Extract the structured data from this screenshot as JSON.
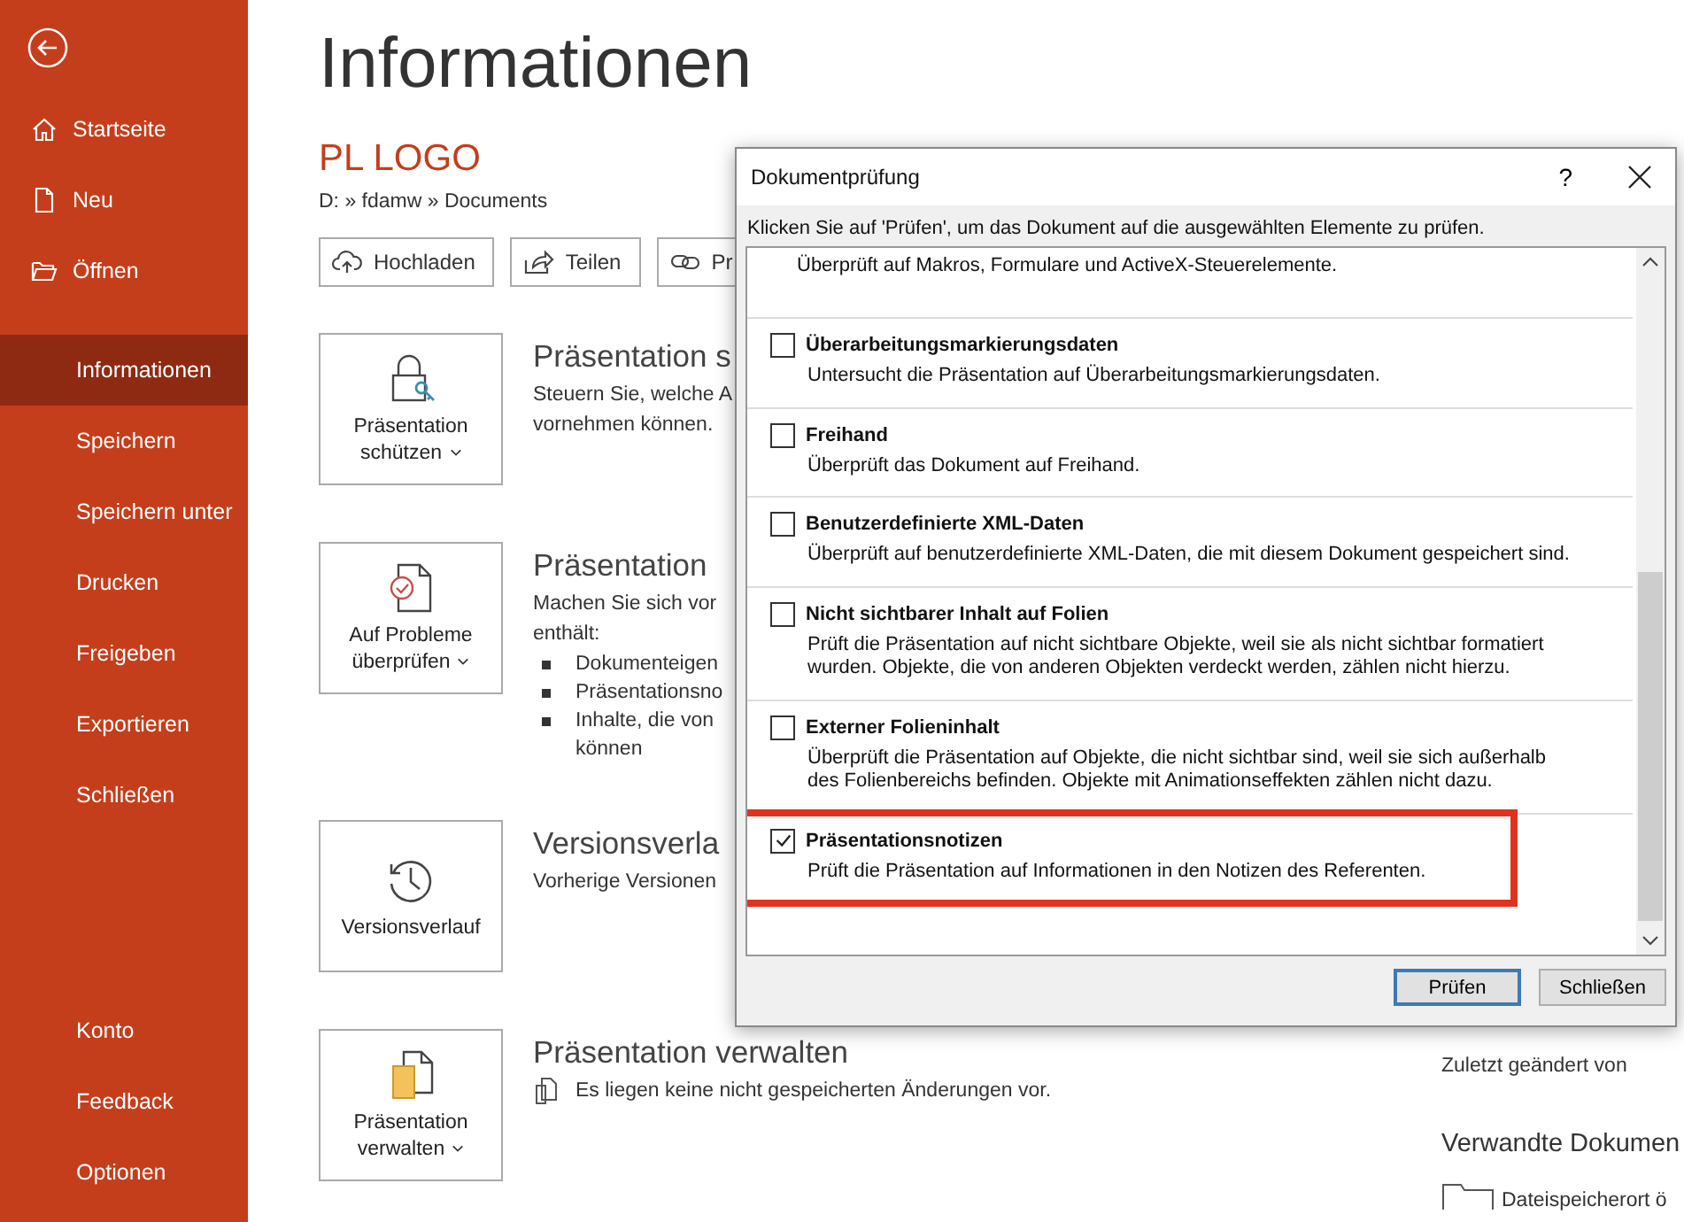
{
  "sidebar": {
    "top_items": [
      {
        "label": "Startseite",
        "selected": false
      },
      {
        "label": "Neu",
        "selected": false
      },
      {
        "label": "Öffnen",
        "selected": false
      }
    ],
    "middle_items": [
      {
        "label": "Informationen",
        "selected": true
      },
      {
        "label": "Speichern",
        "selected": false
      },
      {
        "label": "Speichern unter",
        "selected": false
      },
      {
        "label": "Drucken",
        "selected": false
      },
      {
        "label": "Freigeben",
        "selected": false
      },
      {
        "label": "Exportieren",
        "selected": false
      },
      {
        "label": "Schließen",
        "selected": false
      }
    ],
    "bottom_items": [
      {
        "label": "Konto",
        "selected": false
      },
      {
        "label": "Feedback",
        "selected": false
      },
      {
        "label": "Optionen",
        "selected": false
      }
    ]
  },
  "page_title": "Informationen",
  "document": {
    "name": "PL LOGO",
    "path": "D: » fdamw » Documents"
  },
  "actions": [
    "Hochladen",
    "Teilen",
    "Pr"
  ],
  "sections": [
    {
      "tile": [
        "Präsentation",
        "schützen"
      ],
      "dropdown": true,
      "heading": "Präsentation s",
      "lines": [
        "Steuern Sie, welche A",
        "vornehmen können."
      ]
    },
    {
      "tile": [
        "Auf Probleme",
        "überprüfen"
      ],
      "dropdown": true,
      "heading": "Präsentation",
      "lines": [
        "Machen Sie sich vor",
        "enthält:"
      ],
      "bullets": [
        [
          "Dokumenteigen"
        ],
        [
          "Präsentationsno"
        ],
        [
          "Inhalte, die von",
          "können"
        ]
      ]
    },
    {
      "tile": [
        "Versionsverlauf"
      ],
      "dropdown": false,
      "heading": "Versionsverla",
      "lines": [
        "Vorherige Versionen"
      ]
    },
    {
      "tile": [
        "Präsentation",
        "verwalten"
      ],
      "dropdown": true,
      "heading": "Präsentation verwalten",
      "note": "Es liegen keine nicht gespeicherten Änderungen vor."
    }
  ],
  "right_panel": {
    "modified_by": "Zuletzt geändert von",
    "related_heading": "Verwandte Dokumen",
    "related_item": "Dateispeicherort ö"
  },
  "dialog": {
    "title": "Dokumentprüfung",
    "help": "?",
    "instruction": "Klicken Sie auf 'Prüfen', um das Dokument auf die ausgewählten Elemente zu prüfen.",
    "partial_item_description": "Überprüft auf Makros, Formulare und ActiveX-Steuerelemente.",
    "items": [
      {
        "title": "Überarbeitungsmarkierungsdaten",
        "description": "Untersucht die Präsentation auf Überarbeitungsmarkierungsdaten.",
        "checked": false,
        "highlighted": false
      },
      {
        "title": "Freihand",
        "description": "Überprüft das Dokument auf Freihand.",
        "checked": false,
        "highlighted": false
      },
      {
        "title": "Benutzerdefinierte XML-Daten",
        "description": "Überprüft auf benutzerdefinierte XML-Daten, die mit diesem Dokument gespeichert sind.",
        "checked": false,
        "highlighted": false
      },
      {
        "title": "Nicht sichtbarer Inhalt auf Folien",
        "description": "Prüft die Präsentation auf nicht sichtbare Objekte, weil sie als nicht sichtbar formatiert wurden. Objekte, die von anderen Objekten verdeckt werden, zählen nicht hierzu.",
        "checked": false,
        "highlighted": false
      },
      {
        "title": "Externer Folieninhalt",
        "description": "Überprüft die Präsentation auf Objekte, die nicht sichtbar sind, weil sie sich außerhalb des Folienbereichs befinden. Objekte mit Animationseffekten zählen nicht dazu.",
        "checked": false,
        "highlighted": false
      },
      {
        "title": "Präsentationsnotizen",
        "description": "Prüft die Präsentation auf Informationen in den Notizen des Referenten.",
        "checked": true,
        "highlighted": true
      }
    ],
    "buttons": [
      {
        "label": "Prüfen",
        "default": true
      },
      {
        "label": "Schließen",
        "default": false
      }
    ]
  }
}
